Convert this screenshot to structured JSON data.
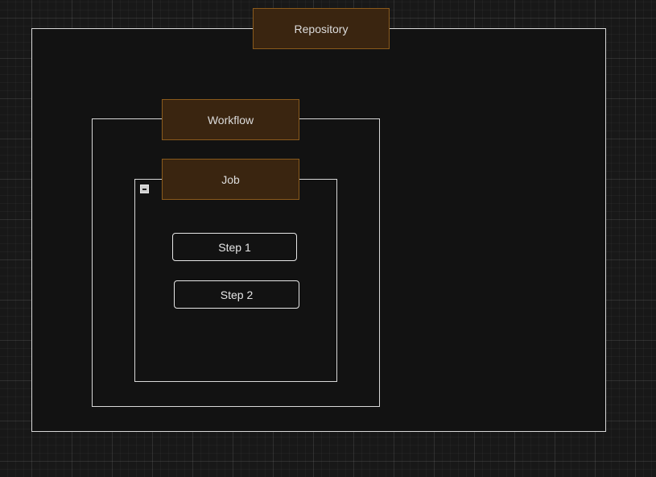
{
  "diagram": {
    "repository": {
      "label": "Repository"
    },
    "workflow": {
      "label": "Workflow"
    },
    "job": {
      "label": "Job"
    },
    "steps": [
      {
        "label": "Step 1"
      },
      {
        "label": "Step 2"
      }
    ]
  },
  "colors": {
    "canvas": "#181818",
    "container_fill": "#121212",
    "container_border": "#d8d8d8",
    "label_fill": "#3a2510",
    "label_border": "#8a5a1c",
    "text": "#dcdcdc"
  },
  "icons": {
    "job_collapse": "collapse-minus-icon"
  }
}
